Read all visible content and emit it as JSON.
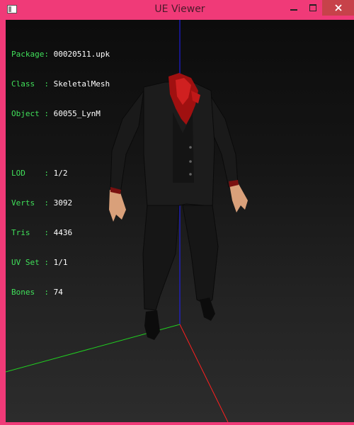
{
  "window": {
    "title": "UE Viewer",
    "accent": "#f03a78"
  },
  "controls": {
    "minimize_icon": "minimize-icon",
    "maximize_icon": "maximize-icon",
    "close_icon": "close-icon"
  },
  "info": {
    "package_label": "Package:",
    "package_value": "00020511.upk",
    "class_label": "Class  :",
    "class_value": "SkeletalMesh",
    "object_label": "Object :",
    "object_value": "60055_LynM",
    "lod_label": "LOD    :",
    "lod_value": "1/2",
    "verts_label": "Verts  :",
    "verts_value": "3092",
    "tris_label": "Tris   :",
    "tris_value": "4436",
    "uvset_label": "UV Set :",
    "uvset_value": "1/1",
    "bones_label": "Bones  :",
    "bones_value": "74"
  },
  "scene": {
    "axis_x_color": "#ff2020",
    "axis_y_color": "#20d020",
    "axis_z_color": "#2020ff"
  }
}
